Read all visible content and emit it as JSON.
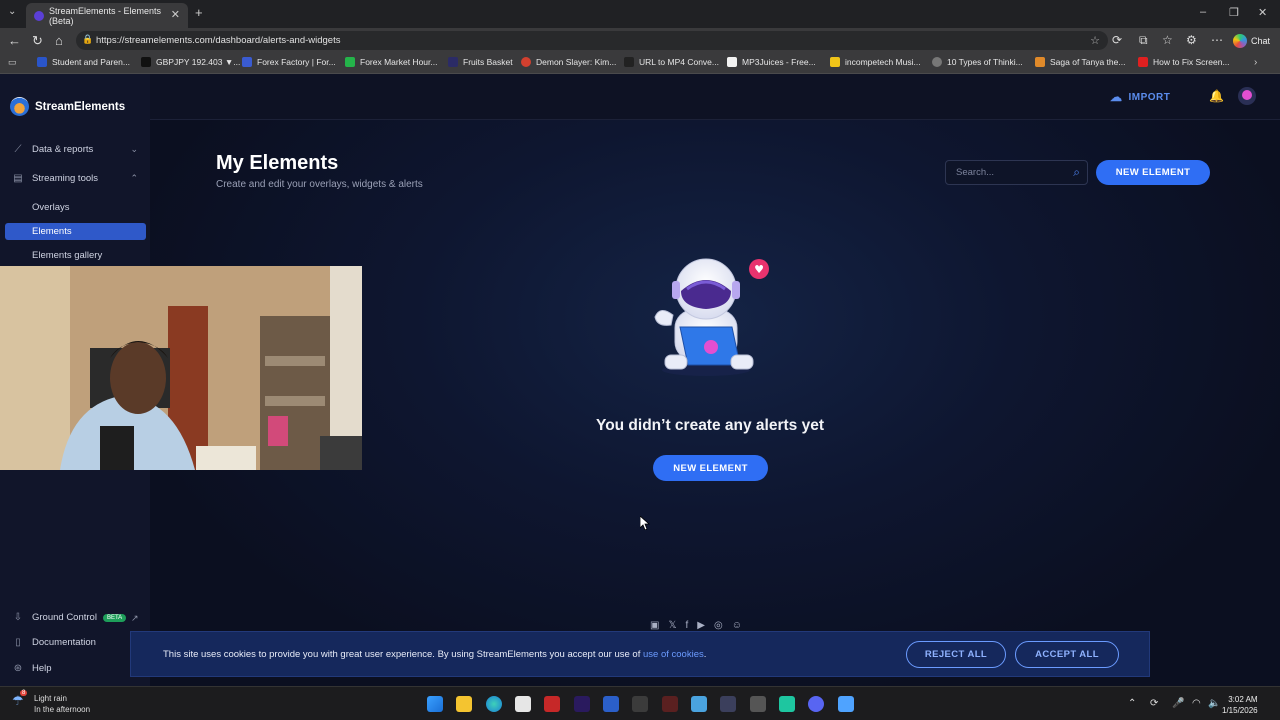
{
  "browser": {
    "tab_title": "StreamElements - Elements (Beta)",
    "url": "https://streamelements.com/dashboard/alerts-and-widgets",
    "chat_label": "Chat",
    "bookmarks": [
      {
        "label": "Student and Paren...",
        "color": "#2a55c9"
      },
      {
        "label": "GBPJPY 192.403 ▼...",
        "color": "#111111"
      },
      {
        "label": "Forex Factory | For...",
        "color": "#3a5bd1"
      },
      {
        "label": "Forex Market Hour...",
        "color": "#24b34a"
      },
      {
        "label": "Fruits Basket",
        "color": "#2b2b66"
      },
      {
        "label": "Demon Slayer: Kim...",
        "color": "#d2402f"
      },
      {
        "label": "URL to MP4 Conve...",
        "color": "#222222"
      },
      {
        "label": "MP3Juices - Free...",
        "color": "#f2f2f2"
      },
      {
        "label": "incompetech Musi...",
        "color": "#f0c419"
      },
      {
        "label": "10 Types of Thinki...",
        "color": "#777777"
      },
      {
        "label": "Saga of Tanya the...",
        "color": "#e08a2a"
      },
      {
        "label": "How to Fix Screen...",
        "color": "#e02020"
      }
    ]
  },
  "sidebar": {
    "brand": "StreamElements",
    "items": [
      {
        "label": "Data & reports",
        "icon": "chart-line-icon"
      },
      {
        "label": "Streaming tools",
        "icon": "layout-icon"
      }
    ],
    "subitems": [
      "Overlays",
      "Elements",
      "Elements gallery"
    ],
    "bottom": [
      {
        "label": "Ground Control",
        "badge": "BETA"
      },
      {
        "label": "Documentation"
      },
      {
        "label": "Help"
      }
    ]
  },
  "header": {
    "import_label": "IMPORT"
  },
  "main": {
    "title": "My Elements",
    "subtitle": "Create and edit your overlays, widgets & alerts",
    "search_placeholder": "Search...",
    "new_element_label": "NEW ELEMENT",
    "empty_message": "You didn’t create any alerts yet",
    "empty_button_label": "NEW ELEMENT"
  },
  "cookie": {
    "text": "This site uses cookies to provide you with great user experience. By using StreamElements you accept our use of",
    "link": "use of cookies",
    "reject_label": "REJECT ALL",
    "accept_label": "ACCEPT ALL"
  },
  "taskbar": {
    "weather_title": "Light rain",
    "weather_sub": "In the afternoon",
    "weather_badge": "8",
    "time": "3:02 AM",
    "date": "1/15/2026"
  }
}
